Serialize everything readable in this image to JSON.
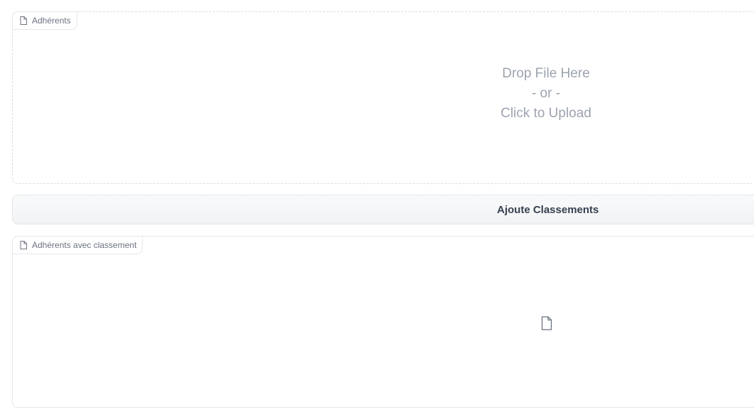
{
  "upload_input": {
    "label": "Adhérents",
    "drop_line1": "Drop File Here",
    "drop_line2": "- or -",
    "drop_line3": "Click to Upload",
    "icon": "file-icon"
  },
  "action_button": {
    "label": "Ajoute Classements"
  },
  "output_file": {
    "label": "Adhérents avec classement",
    "icon": "file-icon",
    "empty_icon": "file-icon"
  },
  "colors": {
    "border": "#e5e7eb",
    "muted_text": "#9ca3af",
    "label_text": "#6b7280",
    "button_text": "#374151"
  }
}
